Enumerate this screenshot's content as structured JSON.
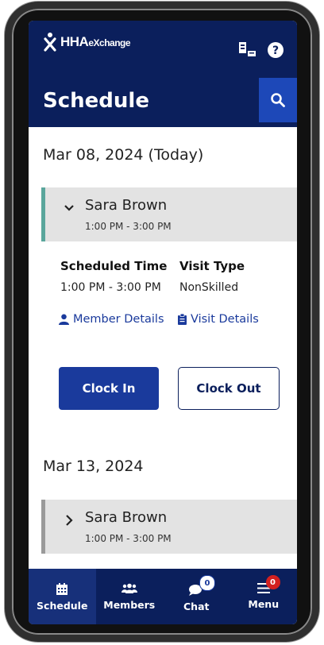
{
  "header": {
    "brand": "HHA",
    "brand_suffix": "eXchange",
    "title": "Schedule",
    "icons": [
      "language-icon",
      "help-icon",
      "search-icon"
    ]
  },
  "schedule": {
    "days": [
      {
        "date": "Mar 08, 2024 (Today)",
        "visit": {
          "name": "Sara Brown",
          "time": "1:00 PM  -  3:00 PM",
          "expanded": true,
          "scheduled_time_label": "Scheduled Time",
          "scheduled_time_value": "1:00 PM - 3:00 PM",
          "visit_type_label": "Visit Type",
          "visit_type_value": "NonSkilled",
          "member_details_link": "Member Details",
          "visit_details_link": "Visit Details",
          "clock_in_label": "Clock In",
          "clock_out_label": "Clock Out"
        }
      },
      {
        "date": "Mar 13, 2024",
        "visit": {
          "name": "Sara Brown",
          "time": "1:00 PM  -  3:00 PM",
          "expanded": false
        }
      }
    ]
  },
  "nav": {
    "items": [
      {
        "label": "Schedule",
        "icon": "calendar-icon",
        "active": true
      },
      {
        "label": "Members",
        "icon": "members-icon"
      },
      {
        "label": "Chat",
        "icon": "chat-icon",
        "badge": "0"
      },
      {
        "label": "Menu",
        "icon": "menu-icon",
        "badge": "0"
      }
    ]
  },
  "colors": {
    "header_bg": "#0b1f5c",
    "accent": "#1a3a9c",
    "today_marker": "#5aa69c",
    "badge_red": "#d32020"
  }
}
